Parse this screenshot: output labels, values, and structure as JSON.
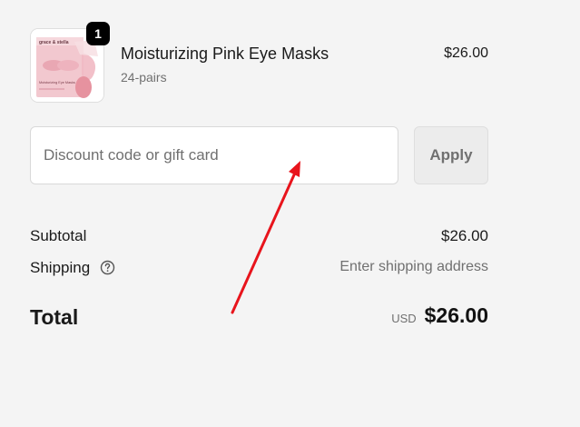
{
  "product": {
    "name": "Moisturizing Pink Eye Masks",
    "variant": "24-pairs",
    "price": "$26.00",
    "quantity": "1",
    "image_icon": "pink-eye-mask-box-image",
    "image_brand_text": "grace & stella",
    "image_label_text": "Moisturizing Eye Masks"
  },
  "discount": {
    "placeholder": "Discount code or gift card",
    "value": "",
    "apply_label": "Apply"
  },
  "summary": {
    "subtotal_label": "Subtotal",
    "subtotal_value": "$26.00",
    "shipping_label": "Shipping",
    "shipping_value": "Enter shipping address",
    "shipping_help_icon": "question-circle-icon",
    "total_label": "Total",
    "total_currency": "USD",
    "total_value": "$26.00"
  },
  "colors": {
    "background": "#f4f4f4",
    "badge": "#000000",
    "annotation_arrow": "#e8141c"
  }
}
